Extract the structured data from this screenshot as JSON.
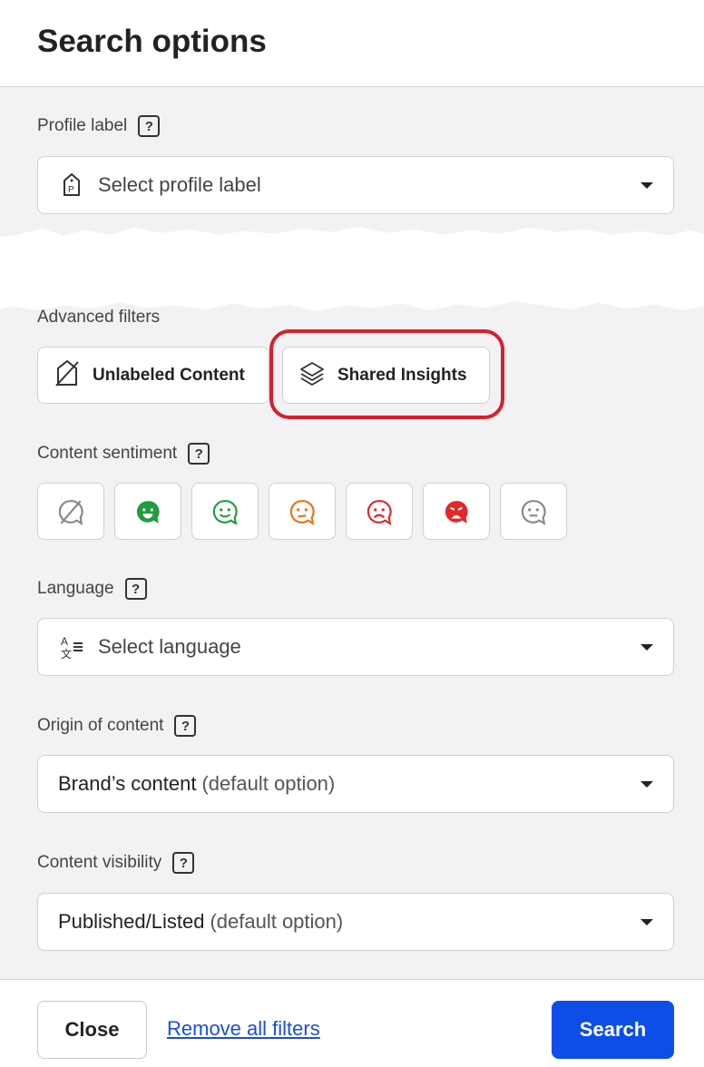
{
  "header": {
    "title": "Search options"
  },
  "profile_label": {
    "label": "Profile label",
    "placeholder": "Select profile label",
    "help": "?"
  },
  "advanced_filters": {
    "label": "Advanced filters",
    "chips": [
      {
        "label": "Unlabeled Content",
        "icon": "tag-off-icon"
      },
      {
        "label": "Shared Insights",
        "icon": "layers-icon",
        "highlighted": true
      }
    ]
  },
  "sentiment": {
    "label": "Content sentiment",
    "help": "?",
    "options": [
      {
        "name": "none",
        "color": "#888888"
      },
      {
        "name": "very-positive",
        "color": "#1f9d3f"
      },
      {
        "name": "positive",
        "color": "#1f9d3f"
      },
      {
        "name": "neutral",
        "color": "#f07010"
      },
      {
        "name": "negative",
        "color": "#e02828"
      },
      {
        "name": "very-negative",
        "color": "#e02828"
      },
      {
        "name": "unknown",
        "color": "#888888"
      }
    ]
  },
  "language": {
    "label": "Language",
    "placeholder": "Select language",
    "help": "?"
  },
  "origin": {
    "label": "Origin of content",
    "value": "Brand’s content",
    "note": "(default option)",
    "help": "?"
  },
  "visibility": {
    "label": "Content visibility",
    "value": "Published/Listed",
    "note": "(default option)",
    "help": "?"
  },
  "footer": {
    "close": "Close",
    "remove": "Remove all filters",
    "search": "Search"
  },
  "colors": {
    "accent": "#0d4ee8",
    "highlight": "#d6202c"
  }
}
